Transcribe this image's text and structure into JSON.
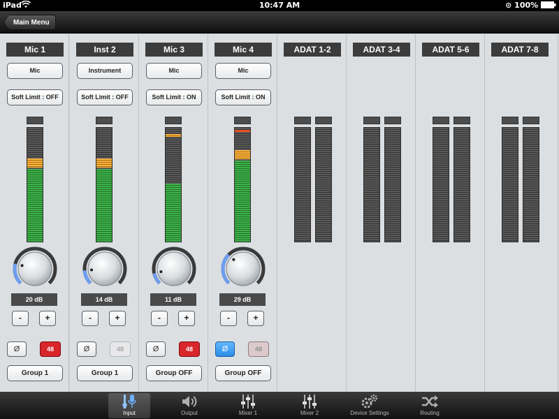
{
  "status_bar": {
    "device": "iPad",
    "time": "10:47 AM",
    "battery": "100%"
  },
  "nav": {
    "back_label": "Main Menu"
  },
  "channels": [
    {
      "name": "Mic 1",
      "type": "Mic",
      "soft_limit": "Soft Limit : OFF",
      "gain": "20 dB",
      "gain_fraction": 0.22,
      "level": 0.73,
      "peak_red": false,
      "minus": "-",
      "plus": "+",
      "phase": "Ø",
      "phase_active": false,
      "phantom": "48",
      "phantom_state": "on",
      "group": "Group 1"
    },
    {
      "name": "Inst 2",
      "type": "Instrument",
      "soft_limit": "Soft Limit : OFF",
      "gain": "14 dB",
      "gain_fraction": 0.15,
      "level": 0.73,
      "peak_red": false,
      "minus": "-",
      "plus": "+",
      "phase": "Ø",
      "phase_active": false,
      "phantom": "48",
      "phantom_state": "off",
      "group": "Group 1"
    },
    {
      "name": "Mic 3",
      "type": "Mic",
      "soft_limit": "Soft Limit : ON",
      "gain": "11 dB",
      "gain_fraction": 0.12,
      "level": 0.6,
      "peak_red": false,
      "minus": "-",
      "plus": "+",
      "phase": "Ø",
      "phase_active": false,
      "phantom": "48",
      "phantom_state": "on",
      "group": "Group OFF"
    },
    {
      "name": "Mic 4",
      "type": "Mic",
      "soft_limit": "Soft Limit : ON",
      "gain": "29 dB",
      "gain_fraction": 0.33,
      "level": 0.8,
      "peak_red": true,
      "minus": "-",
      "plus": "+",
      "phase": "Ø",
      "phase_active": true,
      "phantom": "48",
      "phantom_state": "dim",
      "group": "Group OFF"
    }
  ],
  "adat": [
    {
      "name": "ADAT 1-2"
    },
    {
      "name": "ADAT 3-4"
    },
    {
      "name": "ADAT 5-6"
    },
    {
      "name": "ADAT 7-8"
    }
  ],
  "tabs": [
    {
      "label": "Input",
      "icon": "microphone-guitar-icon",
      "active": true
    },
    {
      "label": "Output",
      "icon": "speaker-icon",
      "active": false
    },
    {
      "label": "Mixer 1",
      "icon": "faders-icon",
      "active": false
    },
    {
      "label": "Mixer 2",
      "icon": "faders-icon",
      "active": false
    },
    {
      "label": "Device Settings",
      "icon": "gears-icon",
      "active": false
    },
    {
      "label": "Routing",
      "icon": "routing-arrows-icon",
      "active": false
    }
  ],
  "colors": {
    "meter_green": "#3fb34a",
    "meter_yellow": "#ffb545",
    "meter_red": "#e8531f",
    "phantom_on": "#d9262b",
    "phase_active": "#2a8ee6",
    "knob_arc": "#6f9ef0"
  }
}
